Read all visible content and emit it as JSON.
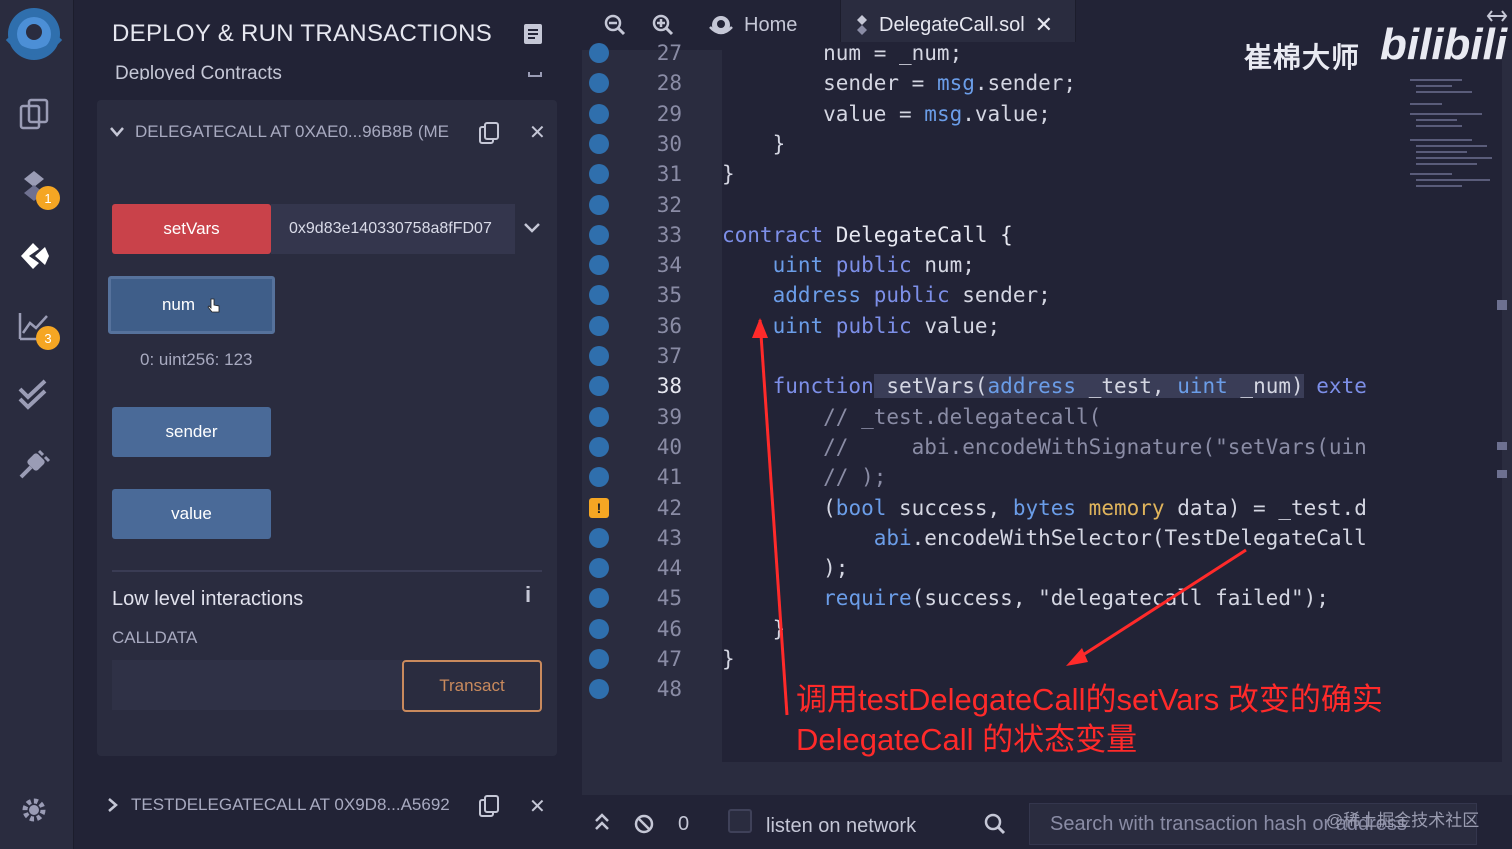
{
  "sidebar": {
    "badges": {
      "solidity": "1",
      "analysis": "3"
    }
  },
  "panel": {
    "title": "DEPLOY & RUN TRANSACTIONS",
    "deployed_header": "Deployed Contracts",
    "instance1": {
      "label": "DELEGATECALL AT 0XAE0...96B8B (ME",
      "setvars_label": "setVars",
      "setvars_arg": "0x9d83e140330758a8fFD07",
      "num_label": "num",
      "num_result": "0: uint256: 123",
      "sender_label": "sender",
      "value_label": "value"
    },
    "low_level": {
      "title": "Low level interactions",
      "calldata_label": "CALLDATA",
      "transact_label": "Transact"
    },
    "instance2": {
      "label": "TESTDELEGATECALL AT 0X9D8...A5692"
    }
  },
  "editor": {
    "tabs": [
      {
        "label": "Home"
      },
      {
        "label": "DelegateCall.sol"
      }
    ],
    "current_line": "38",
    "lines": [
      "27",
      "28",
      "29",
      "30",
      "31",
      "32",
      "33",
      "34",
      "35",
      "36",
      "37",
      "38",
      "39",
      "40",
      "41",
      "42",
      "43",
      "44",
      "45",
      "46",
      "47",
      "48"
    ],
    "code": {
      "l27": "        num = _num;",
      "l28a": "        sender = ",
      "l28b": "msg",
      "l28c": ".sender;",
      "l29a": "        value = ",
      "l29b": "msg",
      "l29c": ".value;",
      "l30": "    }",
      "l31": "}",
      "l33a": "contract",
      "l33b": " DelegateCall {",
      "l34a": "    ",
      "l34b": "uint",
      "l34c": " public",
      "l34d": " num;",
      "l35a": "    ",
      "l35b": "address",
      "l35c": " public",
      "l35d": " sender;",
      "l36a": "    ",
      "l36b": "uint",
      "l36c": " public",
      "l36d": " value;",
      "l38a": "    ",
      "l38b": "function",
      "l38c": " setVars(",
      "l38d": "address",
      "l38e": " _test, ",
      "l38f": "uint",
      "l38g": " _num)",
      "l38h": " exte",
      "l39": "        // _test.delegatecall(",
      "l40a": "        //     abi.encodeWithSignature(\"",
      "l40b": "setVars(uin",
      "l41": "        // );",
      "l42a": "        (",
      "l42b": "bool",
      "l42c": " success, ",
      "l42d": "bytes",
      "l42e": " memory",
      "l42f": " data) = _test.d",
      "l43a": "            ",
      "l43b": "abi",
      "l43c": ".encodeWithSelector(TestDelegateCall",
      "l44": "        );",
      "l45a": "        ",
      "l45b": "require",
      "l45c": "(success, \"delegatecall failed\");",
      "l46": "    }",
      "l47": "}"
    },
    "annotation_line1": "调用testDelegateCall的setVars 改变的确实",
    "annotation_line2": "DelegateCall 的状态变量",
    "watermark_cn": "崔棉大师",
    "watermark_bili": "bilibili"
  },
  "terminal": {
    "count": "0",
    "listen_label": "listen on network",
    "search_placeholder": "Search with transaction hash or address",
    "credit": "@稀土掘金技术社区"
  },
  "colors": {
    "accent_red": "#c9424a",
    "button_blue": "#4a6a98",
    "transact_orange": "#c98a5d",
    "annotation_red": "#ff2a2a",
    "breakpoint_blue": "#2f6fad",
    "warning_orange": "#f5a623"
  }
}
